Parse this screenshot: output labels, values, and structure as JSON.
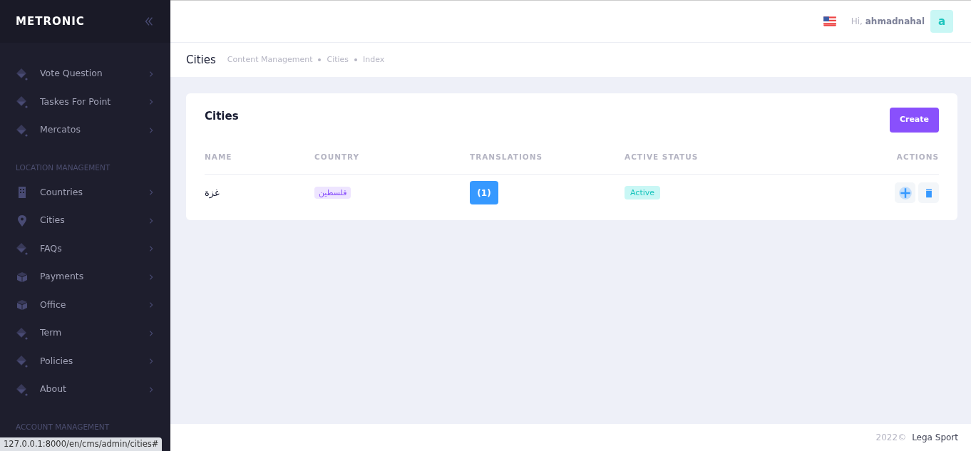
{
  "brand": "METRONIC",
  "sidebar": {
    "sections": [
      {
        "items": [
          {
            "label": "Vote Question",
            "kind": "drop"
          },
          {
            "label": "Taskes For Point",
            "kind": "drop"
          },
          {
            "label": "Mercatos",
            "kind": "drop"
          }
        ]
      },
      {
        "title": "LOCATION MANAGEMENT",
        "items": [
          {
            "label": "Countries",
            "kind": "building"
          },
          {
            "label": "Cities",
            "kind": "pin"
          },
          {
            "label": "FAQs",
            "kind": "drop"
          },
          {
            "label": "Payments",
            "kind": "box"
          },
          {
            "label": "Office",
            "kind": "box"
          },
          {
            "label": "Term",
            "kind": "drop"
          },
          {
            "label": "Policies",
            "kind": "drop"
          },
          {
            "label": "About",
            "kind": "drop"
          }
        ]
      },
      {
        "title": "ACCOUNT MANAGEMENT"
      }
    ]
  },
  "header": {
    "greeting": "Hi,",
    "username": "ahmadnahal",
    "avatar": "a"
  },
  "subheader": {
    "title": "Cities",
    "breadcrumb": [
      "Content Management",
      "Cities",
      "Index"
    ]
  },
  "card": {
    "title": "Cities",
    "create_button": "Create",
    "table": {
      "columns": [
        "NAME",
        "COUNTRY",
        "TRANSLATIONS",
        "ACTIVE STATUS",
        "ACTIONS"
      ],
      "rows": [
        {
          "name": "غزة",
          "country": "فلسطين",
          "translations": "(1)",
          "status": "Active",
          "active": true
        }
      ]
    }
  },
  "footer": {
    "year": "2022©",
    "company": "Lega Sport"
  },
  "status_bar": "127.0.0.1:8000/en/cms/admin/cities#"
}
